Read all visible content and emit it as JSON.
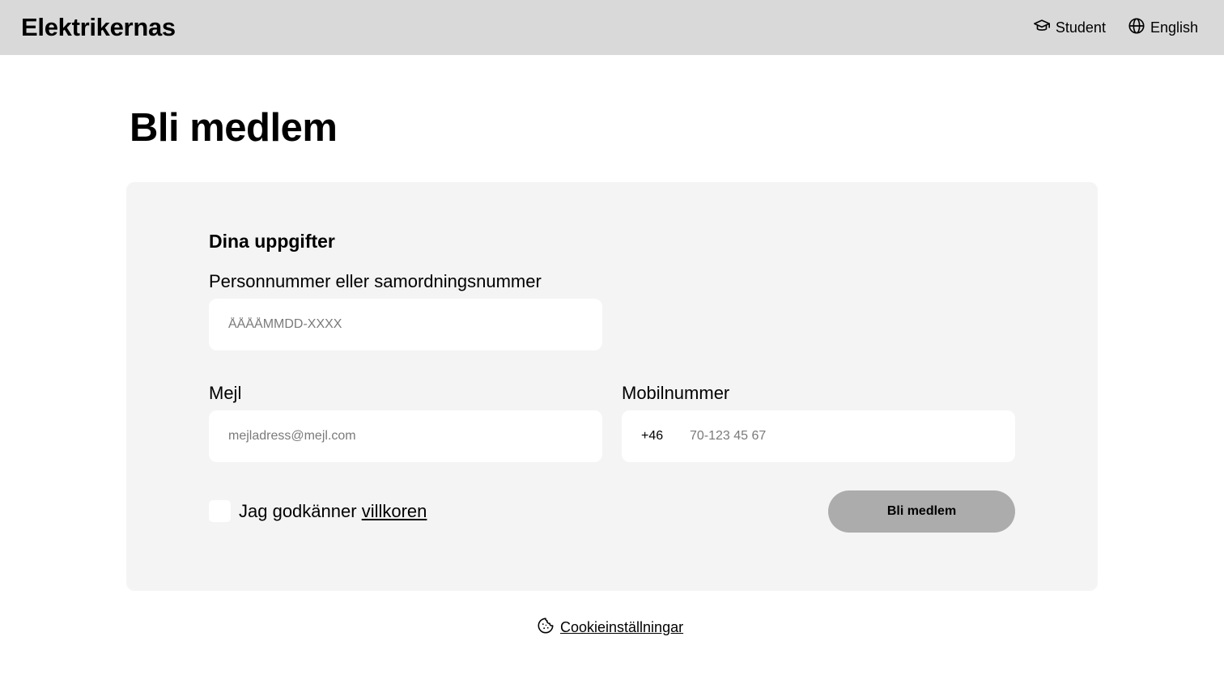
{
  "header": {
    "brand": "Elektrikernas",
    "student_label": "Student",
    "language_label": "English"
  },
  "page": {
    "title": "Bli medlem"
  },
  "form": {
    "section_title": "Dina uppgifter",
    "personnummer": {
      "label": "Personnummer eller samordningsnummer",
      "placeholder": "ÅÅÅÅMMDD-XXXX",
      "value": ""
    },
    "email": {
      "label": "Mejl",
      "placeholder": "mejladress@mejl.com",
      "value": ""
    },
    "mobile": {
      "label": "Mobilnummer",
      "prefix": "+46",
      "placeholder": "70-123 45 67",
      "value": ""
    },
    "consent": {
      "text": "Jag godkänner",
      "link": "villkoren",
      "checked": false
    },
    "submit_label": "Bli medlem"
  },
  "footer": {
    "cookie_label": "Cookieinställningar"
  },
  "colors": {
    "header_bg": "#d9d9d9",
    "card_bg": "#f4f4f4",
    "button_bg": "#acacac"
  }
}
